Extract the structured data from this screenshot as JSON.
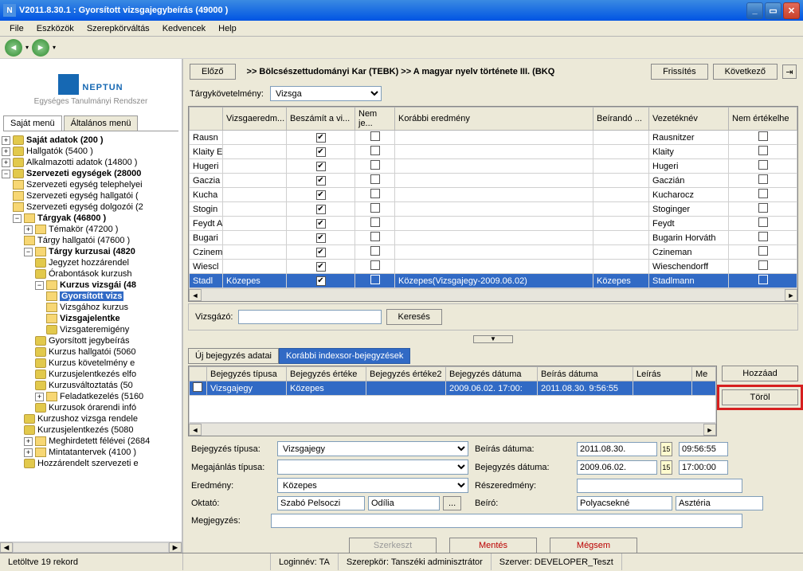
{
  "window": {
    "title": "V2011.8.30.1 : Gyorsított vizsgajegybeírás (49000  )"
  },
  "menu": [
    "File",
    "Eszközök",
    "Szerepkörváltás",
    "Kedvencek",
    "Help"
  ],
  "logo": {
    "text": "NEPTUN",
    "sub": "Egységes Tanulmányi Rendszer"
  },
  "tabs": {
    "a": "Saját menü",
    "b": "Általános menü"
  },
  "tree": {
    "i0": "Saját adatok (200  )",
    "i1": "Hallgatók (5400  )",
    "i2": "Alkalmazotti adatok (14800  )",
    "i3": "Szervezeti egységek (28000",
    "i3a": "Szervezeti egység telephelyei",
    "i3b": "Szervezeti egység hallgatói (",
    "i3c": "Szervezeti egység dolgozói (2",
    "i3d": "Tárgyak (46800  )",
    "i3d1": "Témakör (47200  )",
    "i3d2": "Tárgy hallgatói (47600  )",
    "i3d3": "Tárgy kurzusai (4820",
    "i3d3a": "Jegyzet hozzárendel",
    "i3d3b": "Órabontások kurzush",
    "i3d3c": "Kurzus vizsgái (48",
    "i3d3c1": "Gyorsított vizs",
    "i3d3c2": "Vizsgához kurzus",
    "i3d3c3": "Vizsgajelentke",
    "i3d3c4": "Vizsgateremigény",
    "i3d3d": "Gyorsított jegybeírás",
    "i3d3e": "Kurzus hallgatói (5060",
    "i3d3f": "Kurzus követelmény e",
    "i3d3g": "Kurzusjelentkezés elfo",
    "i3d3h": "Kurzusváltoztatás (50",
    "i3d3i": "Feladatkezelés (5160",
    "i3d3j": "Kurzusok órarendi infó",
    "i3d4": "Kurzushoz vizsga rendele",
    "i3d5": "Kurzusjelentkezés (5080",
    "i3d6": "Meghirdetett félévei (2684",
    "i3d7": "Mintatantervek (4100  )",
    "i3d8": "Hozzárendelt szervezeti e"
  },
  "topnav": {
    "prev": "Előző",
    "breadcrumb": ">>  Bölcsészettudományi Kar (TEBK) >> A magyar nyelv története III.  (BKQ",
    "refresh": "Frissítés",
    "next": "Következő"
  },
  "targyk": {
    "label": "Tárgykövetelmény:",
    "value": "Vizsga"
  },
  "grid": {
    "cols": [
      "",
      "Vizsgaeredm...",
      "Beszámít a vi...",
      "Nem je...",
      "Korábbi eredmény",
      "Beírandó ...",
      "Vezetéknév",
      "Nem értékelhe"
    ],
    "rows": [
      {
        "n": "Rausn",
        "v": "Rausnitzer"
      },
      {
        "n": "Klaity E",
        "v": "Klaity"
      },
      {
        "n": "Hugeri",
        "v": "Hugeri"
      },
      {
        "n": "Gaczia",
        "v": "Gaczián"
      },
      {
        "n": "Kucha",
        "v": "Kucharocz"
      },
      {
        "n": "Stogin",
        "v": "Stoginger"
      },
      {
        "n": "Feydt A",
        "v": "Feydt"
      },
      {
        "n": "Bugari",
        "v": "Bugarin Horváth"
      },
      {
        "n": "Czinem",
        "v": "Czineman"
      },
      {
        "n": "Wiescl",
        "v": "Wieschendorff"
      }
    ],
    "selrow": {
      "n": "Stadl",
      "eredm": "Közepes",
      "korabbi": "Közepes(Vizsgajegy-2009.06.02)",
      "beir": "Közepes",
      "v": "Stadlmann"
    }
  },
  "search": {
    "label": "Vizsgázó:",
    "btn": "Keresés"
  },
  "subtabs": {
    "a": "Új bejegyzés adatai",
    "b": "Korábbi indexsor-bejegyzések"
  },
  "innergrid": {
    "cols": [
      "",
      "Bejegyzés típusa",
      "Bejegyzés értéke",
      "Bejegyzés értéke2",
      "Bejegyzés dátuma",
      "Beírás dátuma",
      "Leírás",
      "Me"
    ],
    "row": {
      "tip": "Vizsgajegy",
      "ert": "Közepes",
      "bd": "2009.06.02. 17:00:",
      "bi": "2011.08.30. 9:56:55"
    }
  },
  "sidebtn": {
    "add": "Hozzáad",
    "del": "Töröl"
  },
  "form": {
    "tip_l": "Bejegyzés típusa:",
    "tip_v": "Vizsgajegy",
    "meg_l": "Megajánlás típusa:",
    "ered_l": "Eredmény:",
    "ered_v": "Közepes",
    "okt_l": "Oktató:",
    "okt_v1": "Szabó Pelsoczi",
    "okt_v2": "Odília",
    "mj_l": "Megjegyzés:",
    "bed_l": "Beírás dátuma:",
    "bed_v": "2011.08.30.",
    "bed_t": "09:56:55",
    "bejd_l": "Bejegyzés dátuma:",
    "bejd_v": "2009.06.02.",
    "bejd_t": "17:00:00",
    "resz_l": "Részeredmény:",
    "beiro_l": "Beíró:",
    "beiro_v1": "Polyacsekné",
    "beiro_v2": "Asztéria"
  },
  "actions": {
    "edit": "Szerkeszt",
    "save": "Mentés",
    "cancel": "Mégsem"
  },
  "status": {
    "left": "Letöltve 19 rekord",
    "login": "Loginnév: TA",
    "role": "Szerepkör: Tanszéki adminisztrátor",
    "srv": "Szerver: DEVELOPER_Teszt"
  }
}
